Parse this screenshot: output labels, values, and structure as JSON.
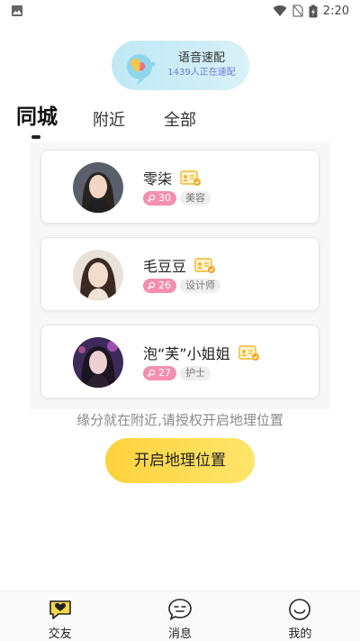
{
  "status_bar": {
    "time": "2:20"
  },
  "voice_match": {
    "title": "语音速配",
    "subtitle": "1439人正在速配"
  },
  "tabs": [
    {
      "label": "同城",
      "active": true
    },
    {
      "label": "附近",
      "active": false
    },
    {
      "label": "全部",
      "active": false
    }
  ],
  "users": [
    {
      "name": "零柒",
      "age": "30",
      "job": "美容"
    },
    {
      "name": "毛豆豆",
      "age": "26",
      "job": "设计师"
    },
    {
      "name": "泡“芙”小姐姐",
      "age": "27",
      "job": "护士"
    }
  ],
  "location": {
    "hint": "缘分就在附近,请授权开启地理位置",
    "button_label": "开启地理位置"
  },
  "bottom_nav": [
    {
      "label": "交友",
      "icon": "heart-chat-icon"
    },
    {
      "label": "消息",
      "icon": "message-icon"
    },
    {
      "label": "我的",
      "icon": "smiley-icon"
    }
  ],
  "colors": {
    "accent_yellow": "#ffd23d",
    "age_badge_pink": "#f48fb1",
    "voice_pill_blue": "#bfe8f5"
  }
}
